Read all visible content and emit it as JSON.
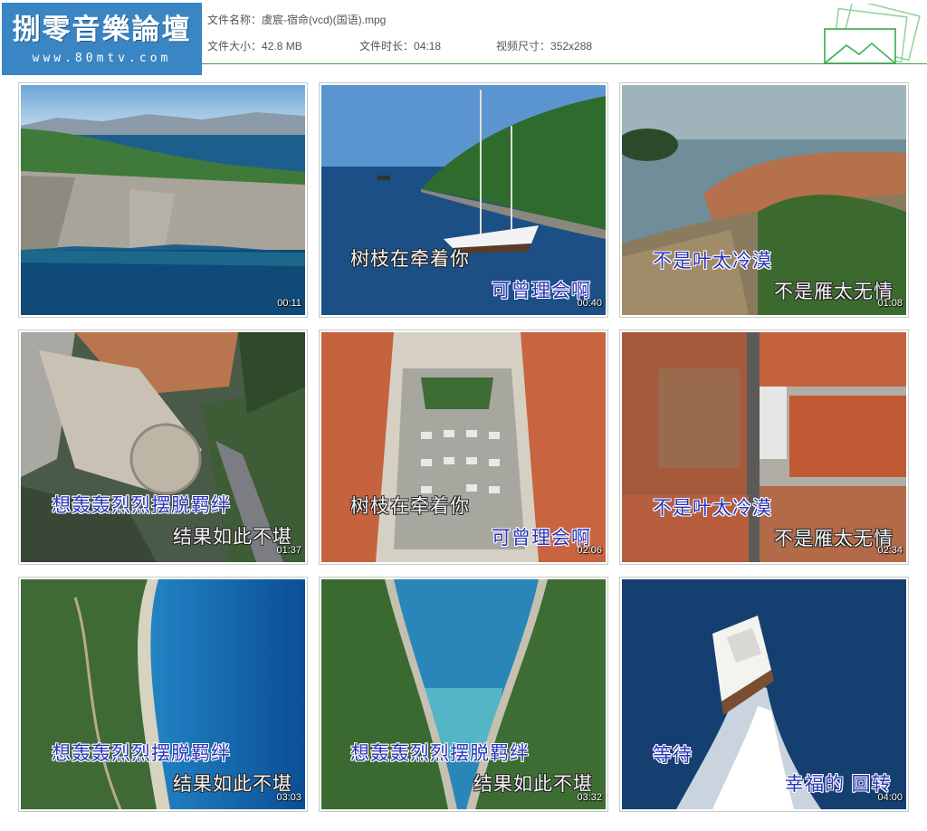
{
  "header": {
    "logo_title": "捌零音樂論壇",
    "logo_url": "www.80mtv.com",
    "file_name_label": "文件名称：",
    "file_name": "虞宸-宿命(vcd)(国语).mpg",
    "file_size_label": "文件大小：",
    "file_size": "42.8 MB",
    "duration_label": "文件时长：",
    "duration": "04:18",
    "dimensions_label": "视频尺寸：",
    "dimensions": "352x288"
  },
  "colors": {
    "logo_bg": "#3a86c4",
    "header_line": "#3aa34a",
    "subtitle_blue": "#2a35b8"
  },
  "thumbnails": [
    {
      "timestamp": "00:11",
      "scene": "coastal-cliffs",
      "lyrics": []
    },
    {
      "timestamp": "00:40",
      "scene": "sailboat-bay",
      "lyrics": [
        "树枝在牵着你",
        "可曾理会啊"
      ]
    },
    {
      "timestamp": "01:08",
      "scene": "old-town-aerial",
      "lyrics": [
        "不是叶太冷漠",
        "不是雁太无情"
      ]
    },
    {
      "timestamp": "01:37",
      "scene": "fortress-aerial",
      "lyrics": [
        "想轰轰烈烈摆脱羁绊",
        "结果如此不堪"
      ]
    },
    {
      "timestamp": "02:06",
      "scene": "cloister-courtyard",
      "lyrics": [
        "树枝在牵着你",
        "可曾理会啊"
      ]
    },
    {
      "timestamp": "02:34",
      "scene": "rooftops-top-down",
      "lyrics": [
        "不是叶太冷漠",
        "不是雁太无情"
      ]
    },
    {
      "timestamp": "03:03",
      "scene": "turquoise-shore",
      "lyrics": [
        "想轰轰烈烈摆脱羁绊",
        "结果如此不堪"
      ]
    },
    {
      "timestamp": "03:32",
      "scene": "lagoon-inlet",
      "lyrics": [
        "想轰轰烈烈摆脱羁绊",
        "结果如此不堪"
      ]
    },
    {
      "timestamp": "04:00",
      "scene": "yacht-wake",
      "lyrics": [
        "等待",
        "幸福的 回转"
      ]
    }
  ]
}
